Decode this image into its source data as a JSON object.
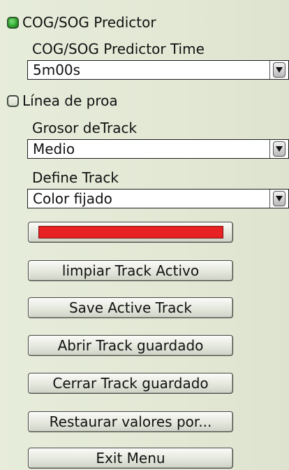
{
  "cog_sog": {
    "checked": true,
    "label": "COG/SOG Predictor",
    "time_label": "COG/SOG Predictor Time",
    "time_value": "5m00s"
  },
  "heading_line": {
    "checked": false,
    "label": "Línea de proa"
  },
  "track_width": {
    "label": "Grosor deTrack",
    "value": "Medio"
  },
  "track_define": {
    "label": "Define Track",
    "value": "Color fijado"
  },
  "track_color": "#e82222",
  "buttons": {
    "clear_active": "limpiar Track Activo",
    "save_active": "Save Active Track",
    "open_saved": "Abrir Track guardado",
    "close_saved": "Cerrar Track guardado",
    "restore_defaults": "Restaurar valores por...",
    "exit": "Exit Menu"
  },
  "icons": {
    "dropdown": "chevron-down-icon"
  }
}
